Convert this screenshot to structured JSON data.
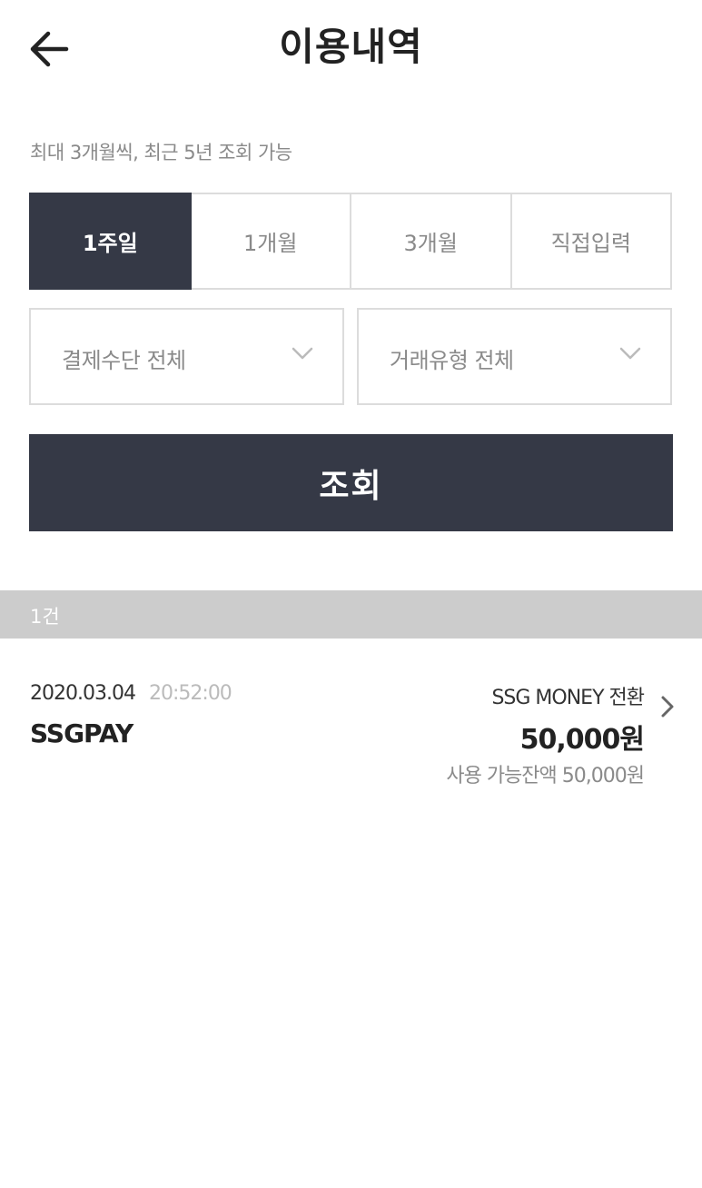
{
  "header": {
    "title": "이용내역",
    "back_icon": "arrow-left-icon"
  },
  "notice": "최대 3개월씩, 최근 5년 조회 가능",
  "period_tabs": [
    {
      "label": "1주일",
      "active": true
    },
    {
      "label": "1개월",
      "active": false
    },
    {
      "label": "3개월",
      "active": false
    },
    {
      "label": "직접입력",
      "active": false
    }
  ],
  "filters": {
    "payment_method": {
      "selected": "결제수단 전체",
      "icon": "chevron-down-icon"
    },
    "transaction_type": {
      "selected": "거래유형 전체",
      "icon": "chevron-down-icon"
    }
  },
  "search_button": {
    "label": "조회"
  },
  "result_count": "1건",
  "transactions": [
    {
      "date": "2020.03.04",
      "time": "20:52:00",
      "merchant": "SSGPAY",
      "type": "SSG MONEY 전환",
      "amount": "50,000원",
      "balance": "사용 가능잔액 50,000원"
    }
  ],
  "colors": {
    "primary_dark": "#353946",
    "count_bar_bg": "#cccccc",
    "border": "#dcdcdc",
    "muted_text": "#8a8a8a"
  }
}
